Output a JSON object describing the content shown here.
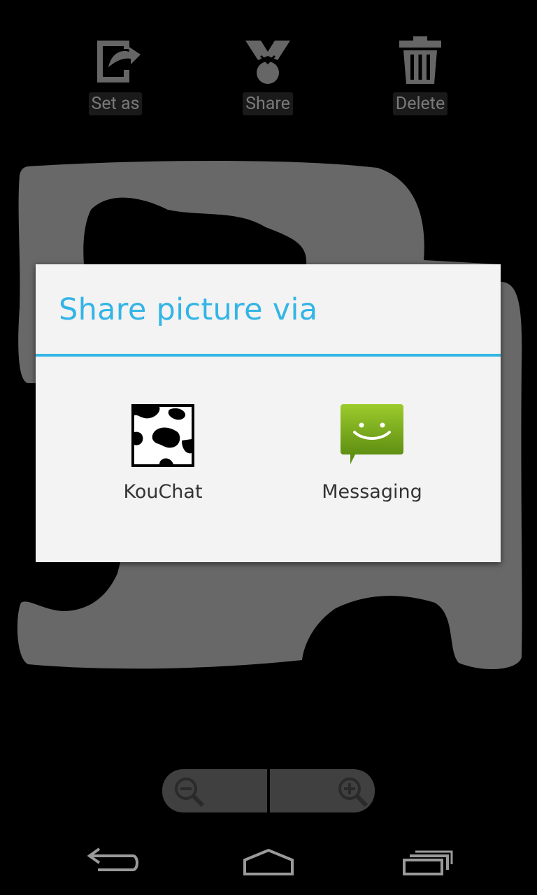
{
  "action_bar": {
    "set_as_label": "Set as",
    "share_label": "Share",
    "delete_label": "Delete",
    "set_as_icon": "set-as-icon",
    "share_icon": "share-icon",
    "delete_icon": "trash-icon"
  },
  "dialog": {
    "title": "Share picture via",
    "accent_color": "#33b5e5",
    "apps": [
      {
        "label": "KouChat",
        "icon": "kouchat-cow-icon"
      },
      {
        "label": "Messaging",
        "icon": "messaging-smiley-icon"
      }
    ]
  },
  "zoom": {
    "zoom_out_icon": "zoom-out-icon",
    "zoom_in_icon": "zoom-in-icon"
  },
  "nav": {
    "back_icon": "back-icon",
    "home_icon": "home-icon",
    "recent_icon": "recent-apps-icon"
  }
}
